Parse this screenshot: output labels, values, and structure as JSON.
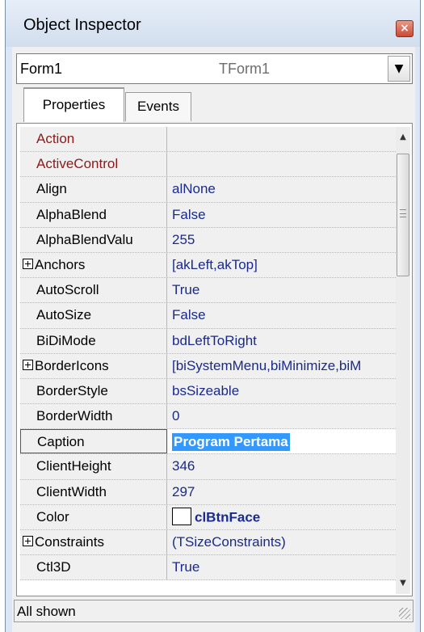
{
  "window": {
    "title": "Object Inspector",
    "close_symbol": "×"
  },
  "selector": {
    "name": "Form1",
    "type": "TForm1",
    "dropdown_symbol": "▼"
  },
  "tabs": [
    {
      "label": "Properties"
    },
    {
      "label": "Events"
    }
  ],
  "properties": [
    {
      "name": "Action",
      "value": ""
    },
    {
      "name": "ActiveControl",
      "value": ""
    },
    {
      "name": "Align",
      "value": "alNone"
    },
    {
      "name": "AlphaBlend",
      "value": "False"
    },
    {
      "name": "AlphaBlendValu",
      "value": "255"
    },
    {
      "name": "Anchors",
      "value": "[akLeft,akTop]"
    },
    {
      "name": "AutoScroll",
      "value": "True"
    },
    {
      "name": "AutoSize",
      "value": "False"
    },
    {
      "name": "BiDiMode",
      "value": "bdLeftToRight"
    },
    {
      "name": "BorderIcons",
      "value": "[biSystemMenu,biMinimize,biM"
    },
    {
      "name": "BorderStyle",
      "value": "bsSizeable"
    },
    {
      "name": "BorderWidth",
      "value": "0"
    },
    {
      "name": "Caption",
      "value": "Program Pertama"
    },
    {
      "name": "ClientHeight",
      "value": "346"
    },
    {
      "name": "ClientWidth",
      "value": "297"
    },
    {
      "name": "Color",
      "value": "clBtnFace"
    },
    {
      "name": "Constraints",
      "value": "(TSizeConstraints)"
    },
    {
      "name": "Ctl3D",
      "value": "True"
    }
  ],
  "scrollbar": {
    "up_symbol": "▲",
    "down_symbol": "▼"
  },
  "status": {
    "text": "All shown"
  },
  "colors": {
    "reference_name": "#8b1a1a",
    "value_text": "#1a2a8c",
    "edit_highlight": "#3399ff"
  }
}
